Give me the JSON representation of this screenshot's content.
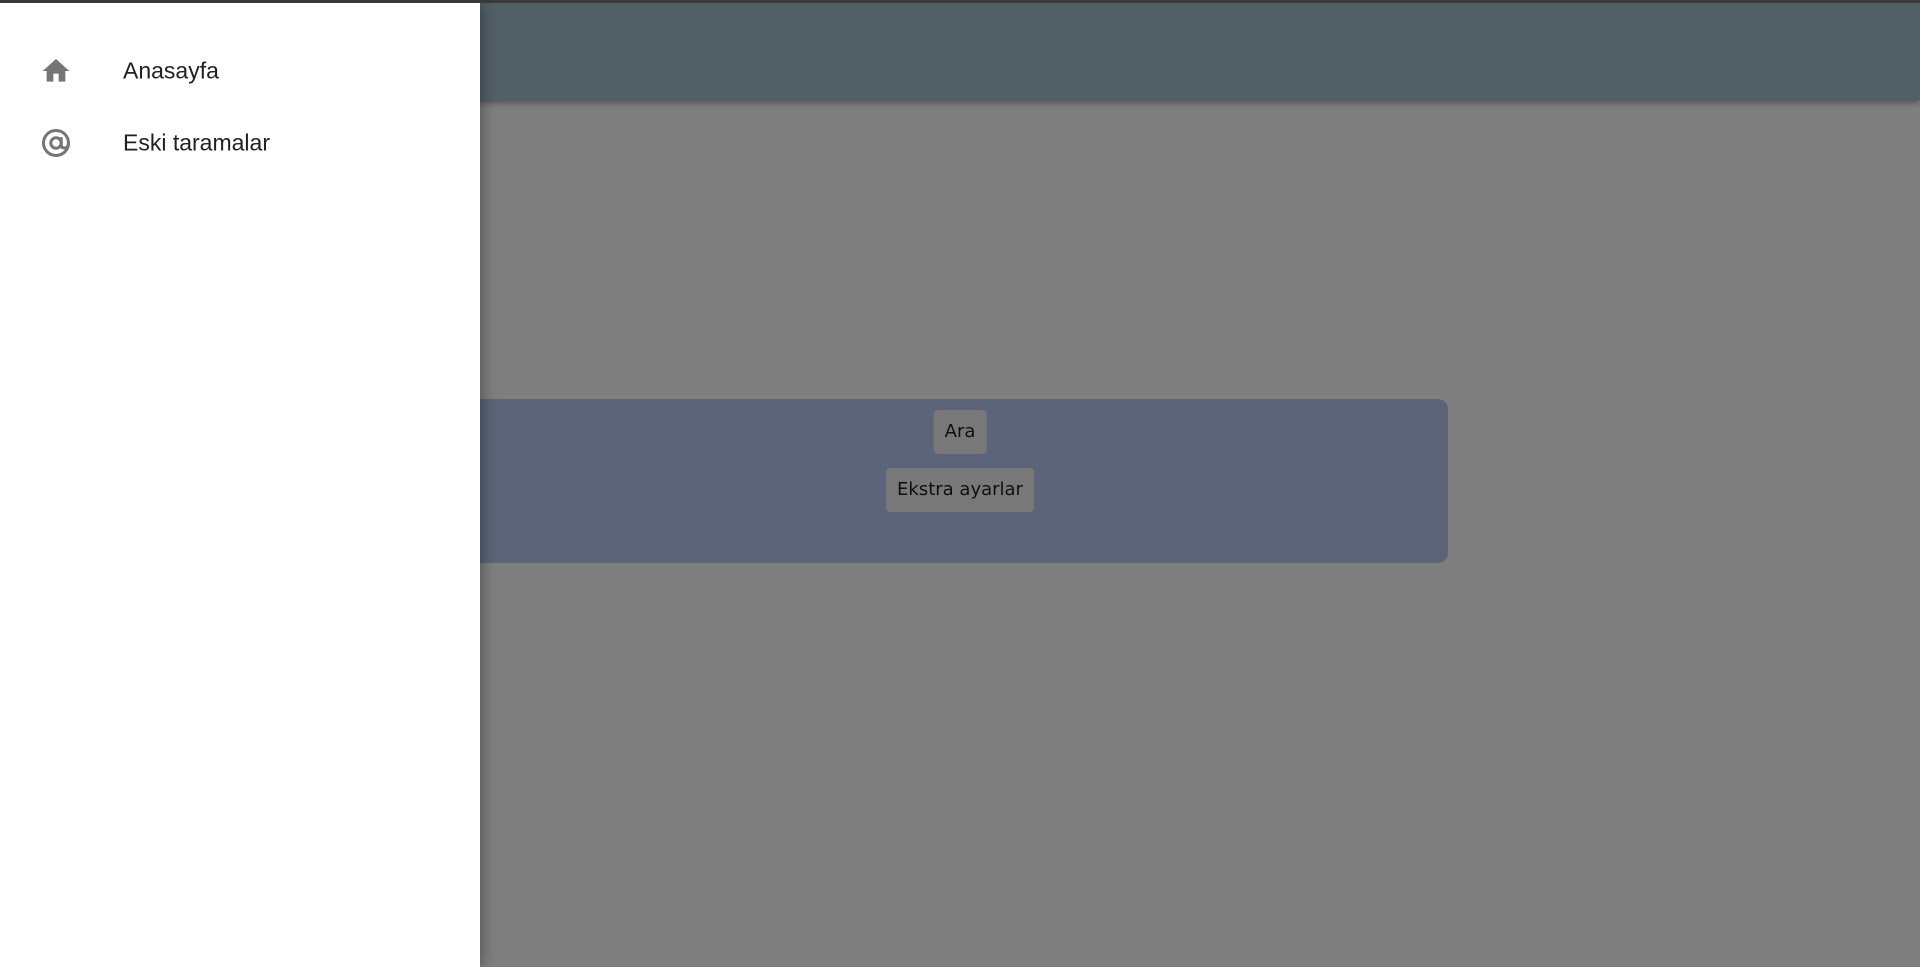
{
  "drawer": {
    "items": [
      {
        "label": "Anasayfa",
        "icon": "home-icon"
      },
      {
        "label": "Eski taramalar",
        "icon": "at-sign-icon"
      }
    ]
  },
  "search_card": {
    "search_button_label": "Ara",
    "extra_settings_button_label": "Ekstra ayarlar"
  },
  "colors": {
    "app_bar": "#a6bfcf",
    "search_card": "#b7c8f0",
    "drawer_background": "#ffffff",
    "icon": "#757575",
    "scrim": "rgba(0,0,0,0.5)"
  }
}
